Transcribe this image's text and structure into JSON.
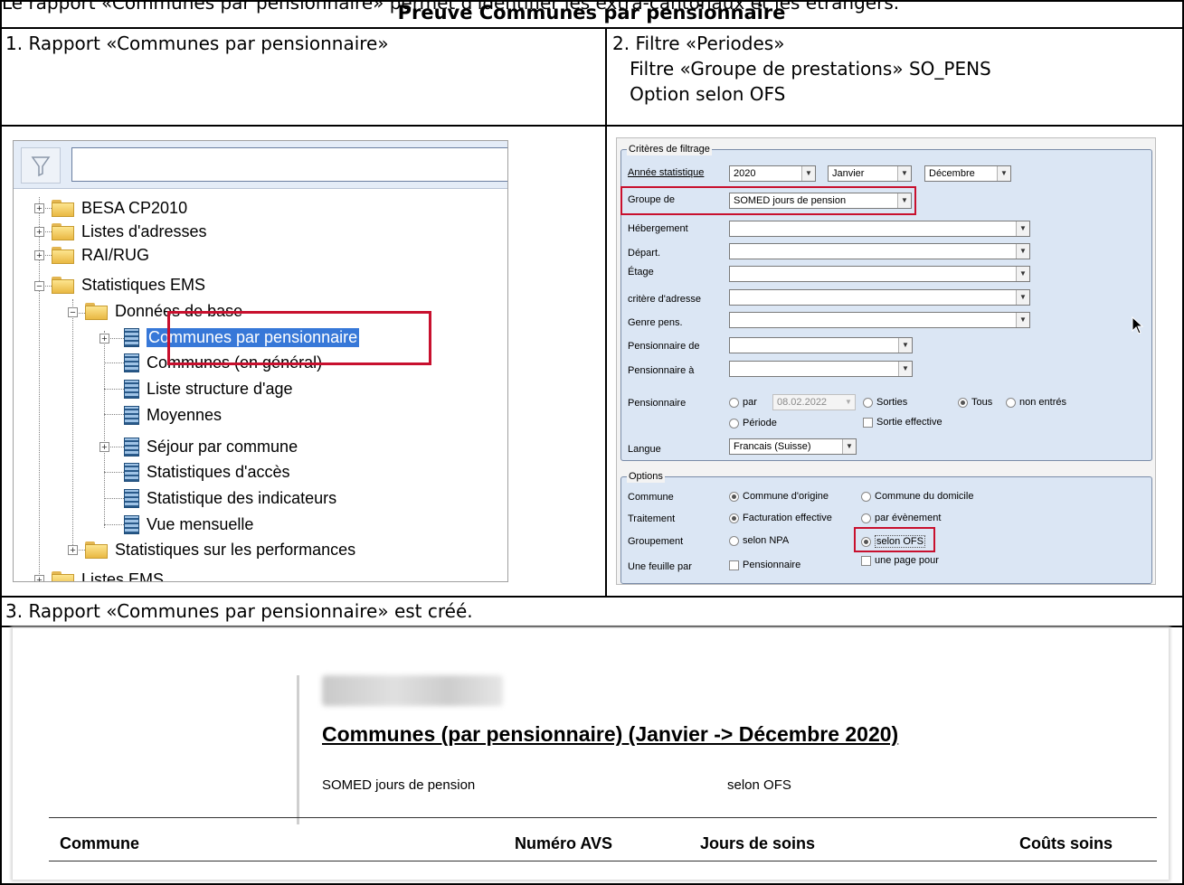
{
  "intro": "Le rapport «Communes par pensionnaire» permet d'identifier les extra-cantonaux et les étrangers.",
  "title": "Preuve Communes par pensionnaire",
  "steps": {
    "s1": "1. Rapport «Communes par pensionnaire»",
    "s2": "2. Filtre «Periodes»\n   Filtre «Groupe de prestations» SO_PENS\n   Option selon OFS",
    "s3": "3. Rapport «Communes par pensionnaire» est créé."
  },
  "tree": {
    "items": [
      "BESA CP2010",
      "Listes d'adresses",
      "RAI/RUG",
      "Statistiques EMS",
      "Données de base",
      "Communes par pensionnaire",
      "Communes (en général)",
      "Liste structure d'age",
      "Moyennes",
      "Séjour par commune",
      "Statistiques d'accès",
      "Statistique des indicateurs",
      "Vue mensuelle",
      "Statistiques sur les performances",
      "Listes EMS"
    ],
    "selected_index": 5
  },
  "dialog": {
    "group_filter": "Critères de filtrage",
    "annee_label": "Année statistique",
    "annee_value": "2020",
    "mois_from": "Janvier",
    "mois_to": "Décembre",
    "groupe_label": "Groupe de",
    "groupe_value": "SOMED jours de pension",
    "hebergement": "Hébergement",
    "depart": "Départ.",
    "etage": "Étage",
    "critere": "critère d'adresse",
    "genre": "Genre pens.",
    "pens_de": "Pensionnaire de",
    "pens_a": "Pensionnaire à",
    "pensionnaire": "Pensionnaire",
    "par": "par",
    "date": "08.02.2022",
    "sorties": "Sorties",
    "tous": "Tous",
    "non_entres": "non entrés",
    "periode": "Période",
    "sortie_eff": "Sortie effective",
    "langue_label": "Langue",
    "langue_value": "Francais (Suisse)",
    "group_options": "Options",
    "commune_label": "Commune",
    "commune_origine": "Commune d'origine",
    "commune_domicile": "Commune du domicile",
    "traitement_label": "Traitement",
    "fact_eff": "Facturation effective",
    "par_evt": "par évènement",
    "groupement_label": "Groupement",
    "npa": "selon NPA",
    "ofs": "selon OFS",
    "feuille_label": "Une feuille par",
    "pens_chk": "Pensionnaire",
    "une_page": "une page pour"
  },
  "report": {
    "title": "Communes (par pensionnaire) (Janvier -> Décembre 2020)",
    "sub1": "SOMED jours de pension",
    "sub2": "selon OFS",
    "cols": [
      "Commune",
      "Numéro AVS",
      "Jours de soins",
      "Coûts soins"
    ]
  },
  "colors": {
    "highlight": "#c8102e",
    "selection": "#3778d8"
  }
}
